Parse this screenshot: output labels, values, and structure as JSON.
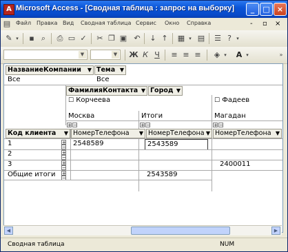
{
  "window": {
    "app_icon": "A",
    "title": "Microsoft Access - [Сводная таблица : запрос на выборку]",
    "minimize": "_",
    "maximize": "□",
    "close": "×"
  },
  "menu": {
    "items": [
      "Файл",
      "Правка",
      "Вид",
      "Сводная таблица",
      "Сервис",
      "Окно",
      "Справка"
    ],
    "doc_controls": [
      "-",
      "▫",
      "×"
    ]
  },
  "toolbar1": {
    "icons": [
      "view-icon",
      "save-icon",
      "search-icon",
      "print-icon",
      "preview-icon",
      "spell-icon",
      "cut-icon",
      "copy-icon",
      "paste-icon",
      "undo-icon",
      "sort-asc-icon",
      "sort-desc-icon",
      "autofilter-icon",
      "fieldlist-icon",
      "properties-icon",
      "help-icon"
    ]
  },
  "toolbar2": {
    "bold": "Ж",
    "italic": "К",
    "underline": "Ч"
  },
  "pivot": {
    "filter_fields": [
      {
        "name": "НазваниеКомпании",
        "value": "Все"
      },
      {
        "name": "Тема",
        "value": "Все"
      }
    ],
    "column_fields": [
      "ФамилияКонтакта",
      "Город"
    ],
    "col_level1": [
      "Корчеева",
      "Фадеев"
    ],
    "col_level2": [
      "Москва",
      "Итоги",
      "Магадан"
    ],
    "row_field": "Код клиента",
    "data_headers": [
      "НомерТелефона",
      "НомерТелефона",
      "НомерТелефона"
    ],
    "rows": [
      {
        "label": "1",
        "values": [
          "2548589",
          "2543589",
          ""
        ]
      },
      {
        "label": "2",
        "values": [
          "",
          "",
          ""
        ]
      },
      {
        "label": "3",
        "values": [
          "",
          "",
          "2400011"
        ]
      },
      {
        "label": "Общие итоги",
        "values": [
          "",
          "2543589",
          ""
        ]
      }
    ]
  },
  "status": {
    "left": "Сводная таблица",
    "right": "NUM"
  }
}
